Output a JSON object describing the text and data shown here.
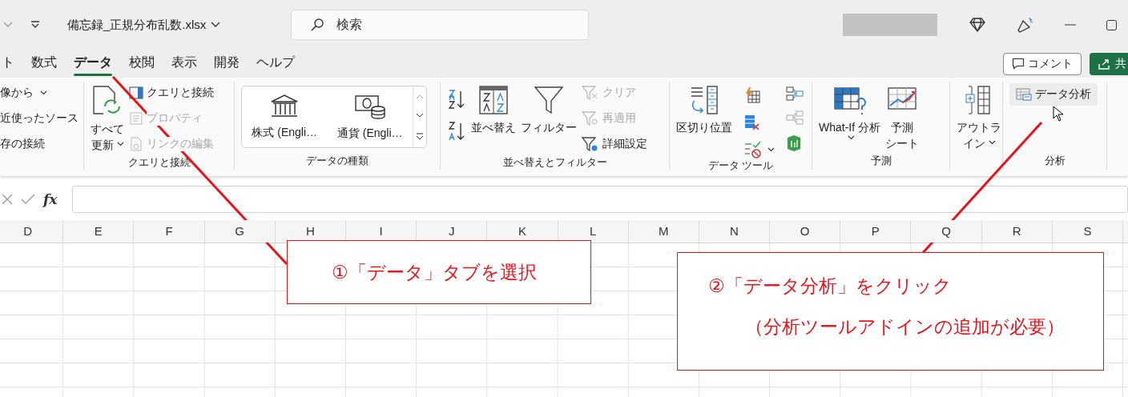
{
  "title_bar": {
    "file_name": "備忘録_正規分布乱数.xlsx",
    "search": {
      "placeholder": "検索"
    }
  },
  "tabs": [
    {
      "label": "ト",
      "selected": false
    },
    {
      "label": "数式",
      "selected": false
    },
    {
      "label": "データ",
      "selected": true
    },
    {
      "label": "校閲",
      "selected": false
    },
    {
      "label": "表示",
      "selected": false
    },
    {
      "label": "開発",
      "selected": false
    },
    {
      "label": "ヘルプ",
      "selected": false
    }
  ],
  "comment_button": "コメント",
  "share_button": "共",
  "ribbon": {
    "groups": [
      {
        "items": [
          {
            "lines": [
              "像から"
            ],
            "dropdown": true
          },
          {
            "lines": [
              "近使ったソース"
            ]
          },
          {
            "lines": [
              "存の接続"
            ]
          }
        ]
      },
      {
        "label": "クエリと接続",
        "items": [
          {
            "lines": [
              "すべて",
              "更新"
            ],
            "dropdown": true
          },
          {
            "lines": [
              "クエリと接続"
            ],
            "disabled": false
          },
          {
            "lines": [
              "プロパティ"
            ],
            "disabled": true
          },
          {
            "lines": [
              "リンクの編集"
            ],
            "disabled": true
          }
        ]
      },
      {
        "label": "データの種類",
        "items": [
          {
            "lines": [
              "株式 (Engli…"
            ]
          },
          {
            "lines": [
              "通貨 (Engli…"
            ]
          }
        ]
      },
      {
        "label": "並べ替えとフィルター",
        "items": [
          {
            "lines": [
              "並べ替え"
            ]
          },
          {
            "lines": [
              "フィルター"
            ]
          },
          {
            "lines": [
              "クリア"
            ],
            "disabled": true
          },
          {
            "lines": [
              "再適用"
            ],
            "disabled": true
          },
          {
            "lines": [
              "詳細設定"
            ],
            "disabled": false
          }
        ]
      },
      {
        "label": "データ ツール",
        "items": [
          {
            "lines": [
              "区切り位置"
            ]
          }
        ]
      },
      {
        "label": "予測",
        "items": [
          {
            "lines": [
              "What-If 分析"
            ],
            "dropdown": true
          },
          {
            "lines": [
              "予測",
              "シート"
            ]
          }
        ]
      },
      {
        "items": [
          {
            "lines": [
              "アウトラ",
              "イン"
            ],
            "dropdown": true
          }
        ]
      },
      {
        "label": "分析",
        "items": [
          {
            "lines": [
              "データ分析"
            ],
            "hovered": true
          }
        ]
      }
    ]
  },
  "formula_bar": {
    "function_label": "fx"
  },
  "columns": [
    "D",
    "E",
    "F",
    "G",
    "H",
    "I",
    "J",
    "K",
    "L",
    "M",
    "N",
    "O",
    "P",
    "Q",
    "R",
    "S"
  ],
  "callouts": [
    {
      "lines": [
        "①「データ」タブを選択"
      ]
    },
    {
      "lines": [
        "②「データ分析」をクリック",
        "（分析ツールアドインの追加が必要）"
      ]
    }
  ]
}
